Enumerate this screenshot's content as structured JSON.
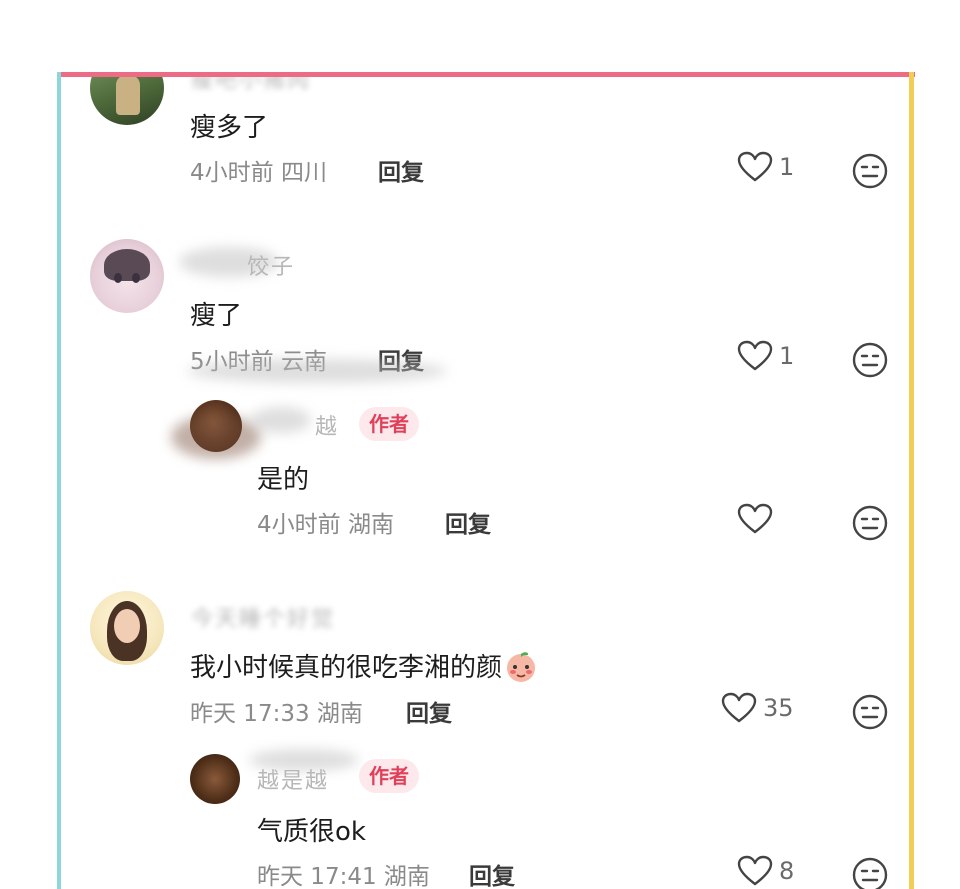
{
  "comments": [
    {
      "username": "瘦吧小猪肉",
      "text": "瘦多了",
      "time": "4小时前",
      "location": "四川",
      "reply_label": "回复",
      "likes": "1"
    },
    {
      "username": "饺子",
      "text": "瘦了",
      "time": "5小时前",
      "location": "云南",
      "reply_label": "回复",
      "likes": "1",
      "reply": {
        "username": "越",
        "badge": "作者",
        "text": "是的",
        "time": "4小时前",
        "location": "湖南",
        "reply_label": "回复",
        "likes": ""
      }
    },
    {
      "username": "今天睡个好觉",
      "text": "我小时候真的很吃李湘的颜",
      "time": "昨天 17:33",
      "location": "湖南",
      "reply_label": "回复",
      "likes": "35",
      "reply": {
        "username": "越是越",
        "badge": "作者",
        "text": "气质很ok",
        "time": "昨天 17:41",
        "location": "湖南",
        "reply_label": "回复",
        "likes": "8"
      }
    }
  ],
  "icons": {
    "like": "heart-outline-icon",
    "dislike": "neutral-face-icon",
    "emoji": "blushing-peach-emoji"
  },
  "colors": {
    "frame_top": "#ee6b86",
    "frame_left": "#8ed6db",
    "frame_right": "#f1cf57",
    "author_badge_text": "#e0405a",
    "author_badge_bg": "#fde8ec"
  }
}
